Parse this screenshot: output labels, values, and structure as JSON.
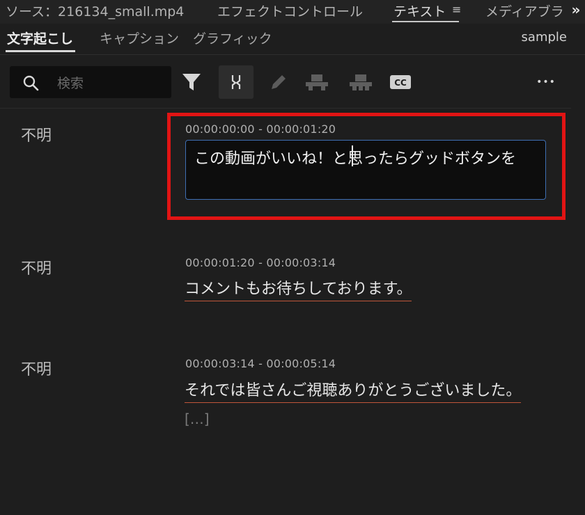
{
  "panel_tabs": {
    "source": "ソース：216134_small.mp4",
    "effect_controls": "エフェクトコントロール",
    "text": "テキスト",
    "menu_glyph": "≡",
    "media_browser": "メディアブラ",
    "overflow_glyph": "»"
  },
  "sub_tabs": {
    "transcript": "文字起こし",
    "captions": "キャプション",
    "graphics": "グラフィック",
    "sequence": "sample"
  },
  "toolbar": {
    "search_placeholder": "検索",
    "icons": [
      "search-icon",
      "filter-icon",
      "merge-segments-icon",
      "edit-pencil-icon",
      "split-segment-icon",
      "join-segment-icon",
      "cc-icon",
      "more-icon"
    ],
    "more_glyph": "•••",
    "cc_label": "CC"
  },
  "transcript": {
    "segments": [
      {
        "speaker": "不明",
        "timecode": "00:00:00:00 - 00:00:01:20",
        "text": "この動画がいいね！と思ったらグッドボタンを",
        "editing": true
      },
      {
        "speaker": "不明",
        "timecode": "00:00:01:20 - 00:00:03:14",
        "text": "コメントもお待ちしております。",
        "editing": false
      },
      {
        "speaker": "不明",
        "timecode": "00:00:03:14 - 00:00:05:14",
        "text": "それでは皆さんご視聴ありがとうございました。",
        "editing": false
      }
    ],
    "trailing_gap": "[…]"
  },
  "colors": {
    "background": "#1e1e1e",
    "highlight_frame": "#e11414",
    "edit_border": "#3e6fb3",
    "text_underline": "#c0563a"
  }
}
